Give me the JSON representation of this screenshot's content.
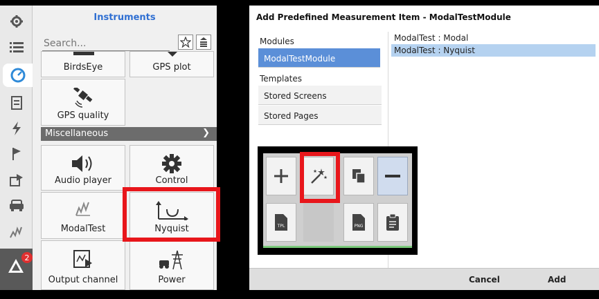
{
  "panel": {
    "title": "Instruments",
    "search_placeholder": "Search...",
    "section_label": "Miscellaneous",
    "tiles": {
      "birdseye": "BirdsEye",
      "gps_plot": "GPS plot",
      "gps_quality": "GPS quality",
      "audio_player": "Audio player",
      "control": "Control",
      "modaltest": "ModalTest",
      "nyquist": "Nyquist",
      "output_channel": "Output channel",
      "power": "Power"
    }
  },
  "sidebar": {
    "notification_count": "2"
  },
  "dialog": {
    "title": "Add Predefined Measurement Item - ModalTestModule",
    "modules_header": "Modules",
    "module_selected": "ModalTestModule",
    "templates_header": "Templates",
    "stored_screens": "Stored Screens",
    "stored_pages": "Stored Pages",
    "items": [
      "ModalTest : Modal",
      "ModalTest : Nyquist"
    ],
    "cancel_label": "Cancel",
    "add_label": "Add"
  },
  "palette": {
    "tpl_label": "TPL",
    "png_label": "PNG"
  },
  "colors": {
    "accent": "#2f6fd2",
    "highlight": "#e8161b",
    "selection": "#5b8fd8"
  }
}
